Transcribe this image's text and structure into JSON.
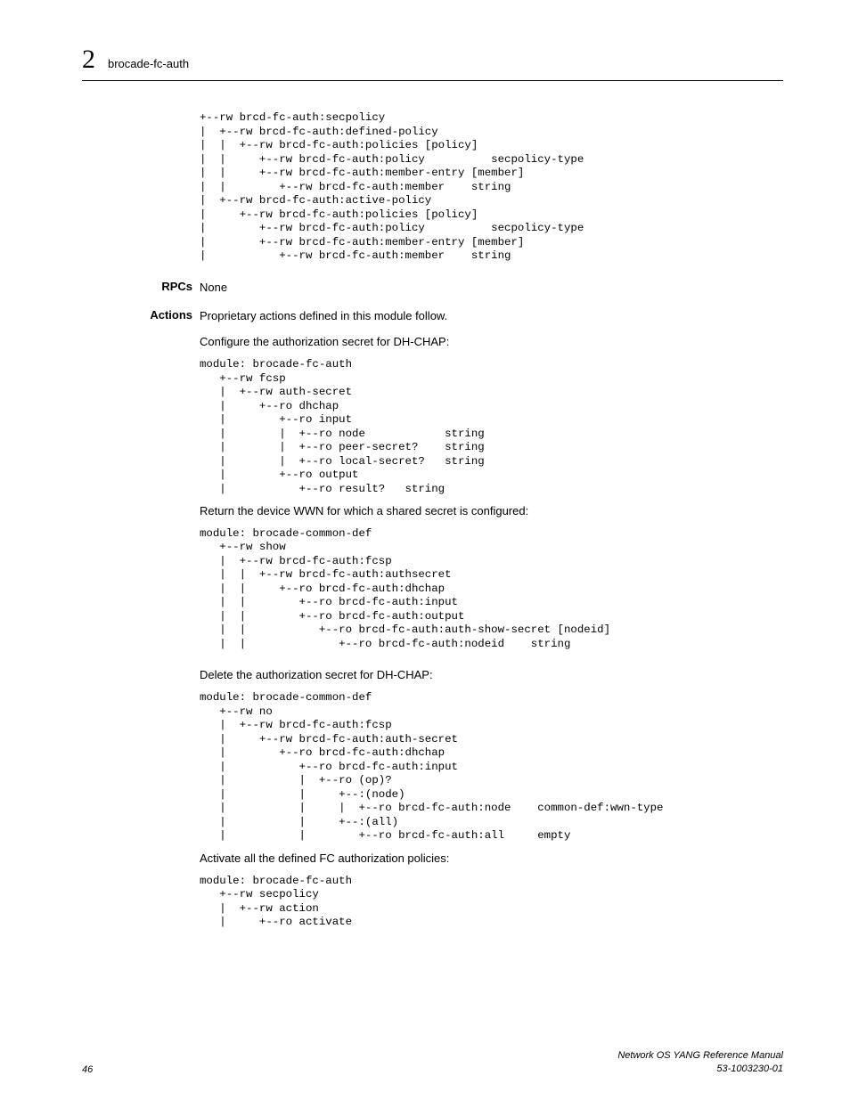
{
  "header": {
    "chapter_number": "2",
    "running_head": "brocade-fc-auth"
  },
  "code_top": "+--rw brcd-fc-auth:secpolicy\n|  +--rw brcd-fc-auth:defined-policy\n|  |  +--rw brcd-fc-auth:policies [policy]\n|  |     +--rw brcd-fc-auth:policy          secpolicy-type\n|  |     +--rw brcd-fc-auth:member-entry [member]\n|  |        +--rw brcd-fc-auth:member    string\n|  +--rw brcd-fc-auth:active-policy\n|     +--rw brcd-fc-auth:policies [policy]\n|        +--rw brcd-fc-auth:policy          secpolicy-type\n|        +--rw brcd-fc-auth:member-entry [member]\n|           +--rw brcd-fc-auth:member    string",
  "rpcs": {
    "label": "RPCs",
    "value": "None"
  },
  "actions": {
    "label": "Actions",
    "intro": "Proprietary actions defined in this module follow.",
    "p1": "Configure the authorization secret for DH-CHAP:",
    "code1": "module: brocade-fc-auth\n   +--rw fcsp\n   |  +--rw auth-secret\n   |     +--ro dhchap\n   |        +--ro input\n   |        |  +--ro node            string\n   |        |  +--ro peer-secret?    string\n   |        |  +--ro local-secret?   string\n   |        +--ro output\n   |           +--ro result?   string",
    "p2": "Return the device WWN for which a shared secret is configured:",
    "code2": "module: brocade-common-def\n   +--rw show\n   |  +--rw brcd-fc-auth:fcsp\n   |  |  +--rw brcd-fc-auth:authsecret\n   |  |     +--ro brcd-fc-auth:dhchap\n   |  |        +--ro brcd-fc-auth:input\n   |  |        +--ro brcd-fc-auth:output\n   |  |           +--ro brcd-fc-auth:auth-show-secret [nodeid]\n   |  |              +--ro brcd-fc-auth:nodeid    string",
    "p3": "Delete the authorization secret for DH-CHAP:",
    "code3": "module: brocade-common-def\n   +--rw no\n   |  +--rw brcd-fc-auth:fcsp\n   |     +--rw brcd-fc-auth:auth-secret\n   |        +--ro brcd-fc-auth:dhchap\n   |           +--ro brcd-fc-auth:input\n   |           |  +--ro (op)?\n   |           |     +--:(node)\n   |           |     |  +--ro brcd-fc-auth:node    common-def:wwn-type\n   |           |     +--:(all)\n   |           |        +--ro brcd-fc-auth:all     empty",
    "p4": "Activate all the defined FC authorization policies:",
    "code4": "module: brocade-fc-auth\n   +--rw secpolicy\n   |  +--rw action\n   |     +--ro activate"
  },
  "footer": {
    "page": "46",
    "manual": "Network OS YANG Reference Manual",
    "docid": "53-1003230-01"
  }
}
